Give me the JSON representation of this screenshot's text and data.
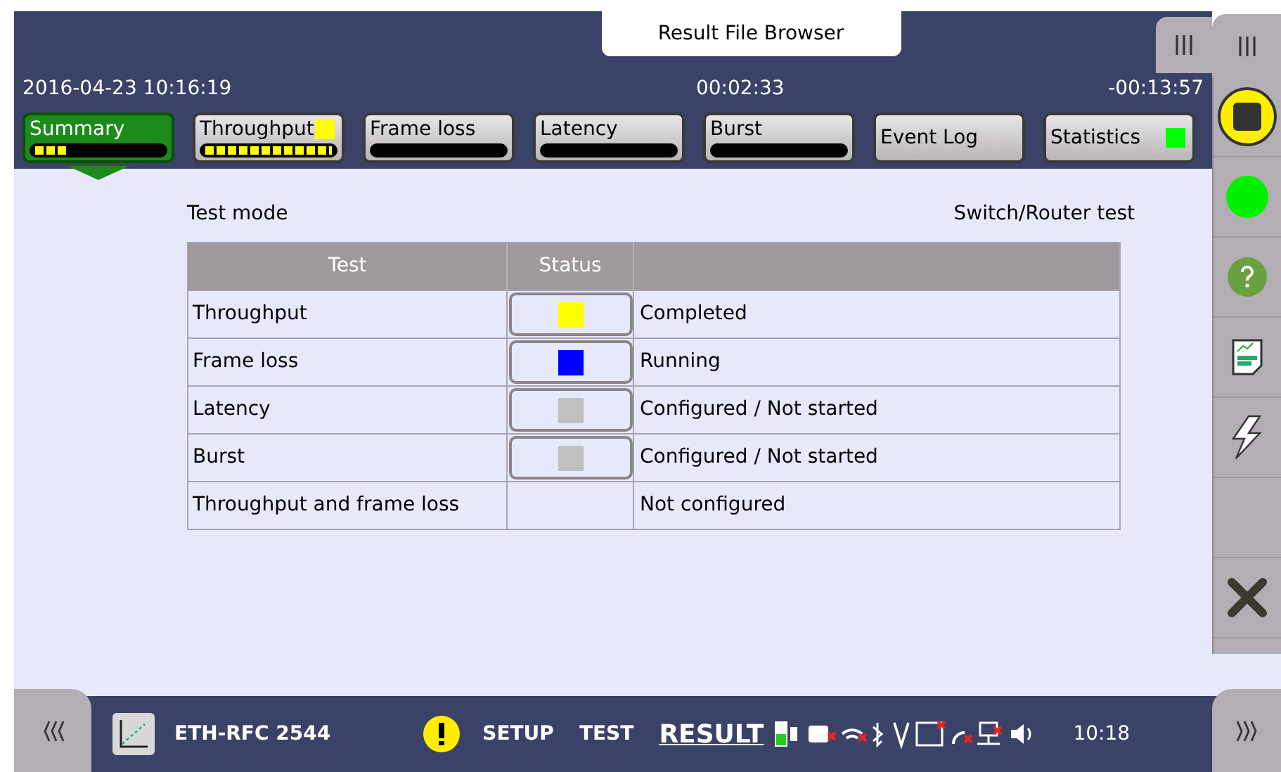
{
  "title_tab": "Result File Browser",
  "header": {
    "datetime": "2016-04-23 10:16:19",
    "elapsed": "00:02:33",
    "remaining": "-00:13:57"
  },
  "tabs": [
    {
      "label": "Summary",
      "selected": true,
      "kind": "progress",
      "level": 0.25
    },
    {
      "label": "Throughput",
      "selected": false,
      "kind": "progress",
      "level": 1,
      "color": "#ffff00"
    },
    {
      "label": "Frame loss",
      "selected": false,
      "kind": "progress"
    },
    {
      "label": "Latency",
      "selected": false,
      "kind": "progress"
    },
    {
      "label": "Burst",
      "selected": false,
      "kind": "progress"
    },
    {
      "label": "Event Log",
      "selected": false,
      "kind": "plain"
    },
    {
      "label": "Statistics",
      "selected": false,
      "kind": "plain",
      "color": "#00ff00"
    }
  ],
  "test_mode": {
    "label": "Test mode",
    "value": "Switch/Router test"
  },
  "table": {
    "columns": [
      "Test",
      "Status"
    ],
    "rows": [
      {
        "test": "Throughput",
        "color": "#ffff00",
        "status": "Completed"
      },
      {
        "test": "Frame loss",
        "color": "#0000ff",
        "status": "Running"
      },
      {
        "test": "Latency",
        "color": "#c0c0c0",
        "status": "Configured / Not started"
      },
      {
        "test": "Burst",
        "color": "#c0c0c0",
        "status": "Configured / Not started"
      },
      {
        "test": "Throughput and frame loss",
        "status": "Not configured"
      }
    ]
  },
  "status_bar": {
    "app": "ETH-RFC 2544",
    "nav": [
      {
        "label": "SETUP",
        "selected": false
      },
      {
        "label": "TEST",
        "selected": false
      },
      {
        "label": "RESULT",
        "selected": true
      }
    ],
    "time": "10:18"
  }
}
